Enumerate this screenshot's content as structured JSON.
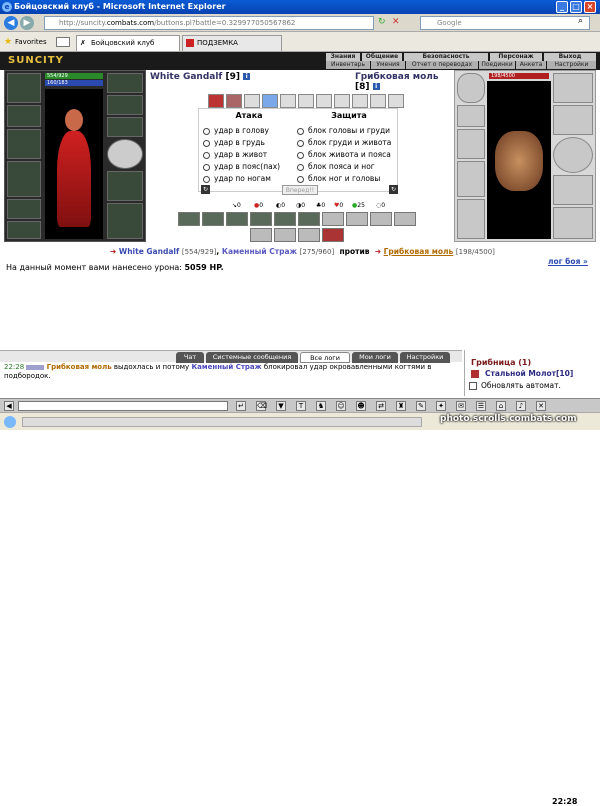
{
  "window": {
    "title": "Бойцовский клуб - Microsoft Internet Explorer"
  },
  "address": {
    "url_prefix": "http://suncity.",
    "url_domain": "combats.com",
    "url_rest": "/buttons.pl?battle=0.329977050567862",
    "search_placeholder": "Google"
  },
  "favorites": {
    "label": "Favorites",
    "tabs": [
      "Бойцовский клуб",
      "ПОДЗЕМКА"
    ]
  },
  "game": {
    "logo": "SUNCITY",
    "top_menu": [
      "Знания",
      "Общение",
      "Безопасность",
      "Персонаж",
      "Выход"
    ],
    "sub_menu": [
      "Инвентарь",
      "Умения",
      "Отчет о переводах",
      "Поединки",
      "Анкета",
      "Настройки"
    ]
  },
  "player": {
    "name": "White Gandalf",
    "level": "[9]",
    "hp": "554/929",
    "mana": "160/183"
  },
  "enemy": {
    "name": "Грибковая моль",
    "level": "[8]",
    "hp": "198/4500"
  },
  "attack": {
    "title": "Атака",
    "options": [
      "удар в голову",
      "удар в грудь",
      "удар в живот",
      "удар в пояс(пах)",
      "удар по ногам"
    ]
  },
  "defense": {
    "title": "Защита",
    "options": [
      "блок головы и груди",
      "блок груди и живота",
      "блок живота и пояса",
      "блок пояса и ног",
      "блок ног и головы"
    ]
  },
  "go_button": "Вперед!!",
  "stats": [
    "0",
    "0",
    "0",
    "0",
    "0",
    "0",
    "25",
    "0"
  ],
  "fight": {
    "me": "White Gandalf",
    "me_hp": "[554/929]",
    "ally": "Каменный Страж",
    "ally_hp": "[275/960]",
    "vs": "против",
    "foe": "Грибковая моль",
    "foe_hp": "[198/4500]"
  },
  "damage": {
    "text": "На данный момент вами нанесено урона:",
    "value": "5059 HP."
  },
  "log_link": "лог боя »",
  "chat_tabs": [
    "Чат",
    "Системные сообщения",
    "Все логи",
    "Мои логи",
    "Настройки"
  ],
  "chat": {
    "time": "22:28",
    "actor": "Грибковая моль",
    "text1": "выдохлась и потому",
    "target": "Каменный Страж",
    "text2": "блокировал удар окровавленными когтями в подбородок."
  },
  "right_chat": {
    "header": "Грибница (1)",
    "member": "Стальной Молот",
    "member_level": "[10]",
    "refresh_label": "Обновлять автомат."
  },
  "clock": "22:28",
  "watermark": "photo.scrolls.combats.com"
}
